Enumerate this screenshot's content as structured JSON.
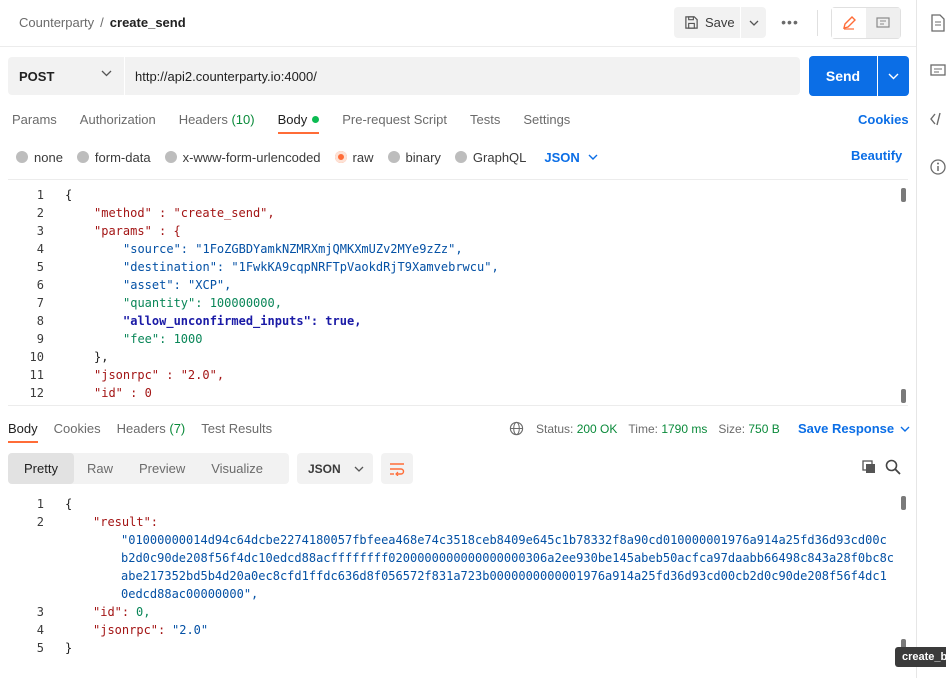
{
  "breadcrumb": {
    "parent": "Counterparty",
    "separator": "/",
    "current": "create_send"
  },
  "toolbar": {
    "save_label": "Save",
    "more_label": "•••"
  },
  "request": {
    "method": "POST",
    "url": "http://api2.counterparty.io:4000/",
    "send_label": "Send"
  },
  "request_tabs": [
    {
      "label": "Params"
    },
    {
      "label": "Authorization"
    },
    {
      "label": "Headers",
      "count": "(10)"
    },
    {
      "label": "Body",
      "active": true
    },
    {
      "label": "Pre-request Script"
    },
    {
      "label": "Tests"
    },
    {
      "label": "Settings"
    }
  ],
  "cookies_label": "Cookies",
  "body_types": [
    "none",
    "form-data",
    "x-www-form-urlencoded",
    "raw",
    "binary",
    "GraphQL"
  ],
  "body_type_selected": "raw",
  "body_language": "JSON",
  "beautify_label": "Beautify",
  "request_body": {
    "line_numbers": [
      "1",
      "2",
      "3",
      "4",
      "5",
      "6",
      "7",
      "8",
      "9",
      "10",
      "11",
      "12"
    ],
    "lines": [
      "{",
      "\"method\" : \"create_send\",",
      "\"params\" : {",
      "\"source\": \"1FoZGBDYamkNZMRXmjQMKXmUZv2MYe9zZz\",",
      "\"destination\": \"1FwkKA9cqpNRFTpVaokdRjT9Xamvebrwcu\",",
      "\"asset\": \"XCP\",",
      "\"quantity\": 100000000,",
      "\"allow_unconfirmed_inputs\": true,",
      "\"fee\": 1000",
      "},",
      "\"jsonrpc\" : \"2.0\",",
      "\"id\" : 0"
    ]
  },
  "response_tabs": [
    {
      "label": "Body",
      "active": true
    },
    {
      "label": "Cookies"
    },
    {
      "label": "Headers",
      "count": "(7)"
    },
    {
      "label": "Test Results"
    }
  ],
  "response_meta": {
    "status_label": "Status:",
    "status_value": "200 OK",
    "time_label": "Time:",
    "time_value": "1790 ms",
    "size_label": "Size:",
    "size_value": "750 B",
    "save_response_label": "Save Response"
  },
  "response_views": [
    "Pretty",
    "Raw",
    "Preview",
    "Visualize"
  ],
  "response_view_active": "Pretty",
  "response_language": "JSON",
  "response_body": {
    "line_numbers": [
      "1",
      "2",
      "",
      "",
      "",
      "3",
      "4",
      "5"
    ],
    "key_result": "\"result\":",
    "result_lines": [
      "\"01000000014d94c64dcbe2274180057fbfeea468e74c3518ceb8409e645c1b78332f8a90cd010000001976a914a25fd36d93cd00c",
      "b2d0c90de208f56f4dc10edcd88acffffffff0200000000000000000306a2ee930be145abeb50acfca97daabb66498c843a28f0bc8c",
      "abe217352bd5b4d20a0ec8cfd1ffdc636d8f056572f831a723b0000000000001976a914a25fd36d93cd00cb2d0c90de208f56f4dc1",
      "0edcd88ac00000000\","
    ],
    "id_key": "\"id\":",
    "id_value": "0,",
    "jsonrpc_key": "\"jsonrpc\":",
    "jsonrpc_value": "\"2.0\"",
    "open": "{",
    "close": "}"
  },
  "tooltip": "create_b",
  "colors": {
    "accent": "#ff6c37",
    "primary": "#0b6ee6",
    "success": "#0a8a3a"
  }
}
